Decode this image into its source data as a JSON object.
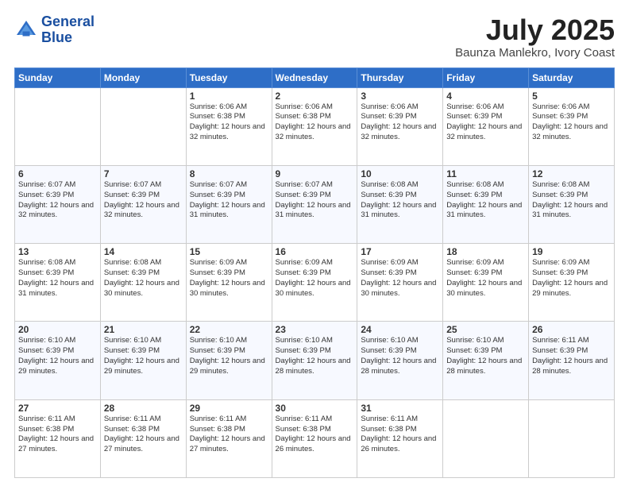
{
  "logo": {
    "line1": "General",
    "line2": "Blue"
  },
  "title": "July 2025",
  "location": "Baunza Manlekro, Ivory Coast",
  "weekdays": [
    "Sunday",
    "Monday",
    "Tuesday",
    "Wednesday",
    "Thursday",
    "Friday",
    "Saturday"
  ],
  "weeks": [
    [
      {
        "day": "",
        "sunrise": "",
        "sunset": "",
        "daylight": ""
      },
      {
        "day": "",
        "sunrise": "",
        "sunset": "",
        "daylight": ""
      },
      {
        "day": "1",
        "sunrise": "Sunrise: 6:06 AM",
        "sunset": "Sunset: 6:38 PM",
        "daylight": "Daylight: 12 hours and 32 minutes."
      },
      {
        "day": "2",
        "sunrise": "Sunrise: 6:06 AM",
        "sunset": "Sunset: 6:38 PM",
        "daylight": "Daylight: 12 hours and 32 minutes."
      },
      {
        "day": "3",
        "sunrise": "Sunrise: 6:06 AM",
        "sunset": "Sunset: 6:39 PM",
        "daylight": "Daylight: 12 hours and 32 minutes."
      },
      {
        "day": "4",
        "sunrise": "Sunrise: 6:06 AM",
        "sunset": "Sunset: 6:39 PM",
        "daylight": "Daylight: 12 hours and 32 minutes."
      },
      {
        "day": "5",
        "sunrise": "Sunrise: 6:06 AM",
        "sunset": "Sunset: 6:39 PM",
        "daylight": "Daylight: 12 hours and 32 minutes."
      }
    ],
    [
      {
        "day": "6",
        "sunrise": "Sunrise: 6:07 AM",
        "sunset": "Sunset: 6:39 PM",
        "daylight": "Daylight: 12 hours and 32 minutes."
      },
      {
        "day": "7",
        "sunrise": "Sunrise: 6:07 AM",
        "sunset": "Sunset: 6:39 PM",
        "daylight": "Daylight: 12 hours and 32 minutes."
      },
      {
        "day": "8",
        "sunrise": "Sunrise: 6:07 AM",
        "sunset": "Sunset: 6:39 PM",
        "daylight": "Daylight: 12 hours and 31 minutes."
      },
      {
        "day": "9",
        "sunrise": "Sunrise: 6:07 AM",
        "sunset": "Sunset: 6:39 PM",
        "daylight": "Daylight: 12 hours and 31 minutes."
      },
      {
        "day": "10",
        "sunrise": "Sunrise: 6:08 AM",
        "sunset": "Sunset: 6:39 PM",
        "daylight": "Daylight: 12 hours and 31 minutes."
      },
      {
        "day": "11",
        "sunrise": "Sunrise: 6:08 AM",
        "sunset": "Sunset: 6:39 PM",
        "daylight": "Daylight: 12 hours and 31 minutes."
      },
      {
        "day": "12",
        "sunrise": "Sunrise: 6:08 AM",
        "sunset": "Sunset: 6:39 PM",
        "daylight": "Daylight: 12 hours and 31 minutes."
      }
    ],
    [
      {
        "day": "13",
        "sunrise": "Sunrise: 6:08 AM",
        "sunset": "Sunset: 6:39 PM",
        "daylight": "Daylight: 12 hours and 31 minutes."
      },
      {
        "day": "14",
        "sunrise": "Sunrise: 6:08 AM",
        "sunset": "Sunset: 6:39 PM",
        "daylight": "Daylight: 12 hours and 30 minutes."
      },
      {
        "day": "15",
        "sunrise": "Sunrise: 6:09 AM",
        "sunset": "Sunset: 6:39 PM",
        "daylight": "Daylight: 12 hours and 30 minutes."
      },
      {
        "day": "16",
        "sunrise": "Sunrise: 6:09 AM",
        "sunset": "Sunset: 6:39 PM",
        "daylight": "Daylight: 12 hours and 30 minutes."
      },
      {
        "day": "17",
        "sunrise": "Sunrise: 6:09 AM",
        "sunset": "Sunset: 6:39 PM",
        "daylight": "Daylight: 12 hours and 30 minutes."
      },
      {
        "day": "18",
        "sunrise": "Sunrise: 6:09 AM",
        "sunset": "Sunset: 6:39 PM",
        "daylight": "Daylight: 12 hours and 30 minutes."
      },
      {
        "day": "19",
        "sunrise": "Sunrise: 6:09 AM",
        "sunset": "Sunset: 6:39 PM",
        "daylight": "Daylight: 12 hours and 29 minutes."
      }
    ],
    [
      {
        "day": "20",
        "sunrise": "Sunrise: 6:10 AM",
        "sunset": "Sunset: 6:39 PM",
        "daylight": "Daylight: 12 hours and 29 minutes."
      },
      {
        "day": "21",
        "sunrise": "Sunrise: 6:10 AM",
        "sunset": "Sunset: 6:39 PM",
        "daylight": "Daylight: 12 hours and 29 minutes."
      },
      {
        "day": "22",
        "sunrise": "Sunrise: 6:10 AM",
        "sunset": "Sunset: 6:39 PM",
        "daylight": "Daylight: 12 hours and 29 minutes."
      },
      {
        "day": "23",
        "sunrise": "Sunrise: 6:10 AM",
        "sunset": "Sunset: 6:39 PM",
        "daylight": "Daylight: 12 hours and 28 minutes."
      },
      {
        "day": "24",
        "sunrise": "Sunrise: 6:10 AM",
        "sunset": "Sunset: 6:39 PM",
        "daylight": "Daylight: 12 hours and 28 minutes."
      },
      {
        "day": "25",
        "sunrise": "Sunrise: 6:10 AM",
        "sunset": "Sunset: 6:39 PM",
        "daylight": "Daylight: 12 hours and 28 minutes."
      },
      {
        "day": "26",
        "sunrise": "Sunrise: 6:11 AM",
        "sunset": "Sunset: 6:39 PM",
        "daylight": "Daylight: 12 hours and 28 minutes."
      }
    ],
    [
      {
        "day": "27",
        "sunrise": "Sunrise: 6:11 AM",
        "sunset": "Sunset: 6:38 PM",
        "daylight": "Daylight: 12 hours and 27 minutes."
      },
      {
        "day": "28",
        "sunrise": "Sunrise: 6:11 AM",
        "sunset": "Sunset: 6:38 PM",
        "daylight": "Daylight: 12 hours and 27 minutes."
      },
      {
        "day": "29",
        "sunrise": "Sunrise: 6:11 AM",
        "sunset": "Sunset: 6:38 PM",
        "daylight": "Daylight: 12 hours and 27 minutes."
      },
      {
        "day": "30",
        "sunrise": "Sunrise: 6:11 AM",
        "sunset": "Sunset: 6:38 PM",
        "daylight": "Daylight: 12 hours and 26 minutes."
      },
      {
        "day": "31",
        "sunrise": "Sunrise: 6:11 AM",
        "sunset": "Sunset: 6:38 PM",
        "daylight": "Daylight: 12 hours and 26 minutes."
      },
      {
        "day": "",
        "sunrise": "",
        "sunset": "",
        "daylight": ""
      },
      {
        "day": "",
        "sunrise": "",
        "sunset": "",
        "daylight": ""
      }
    ]
  ]
}
